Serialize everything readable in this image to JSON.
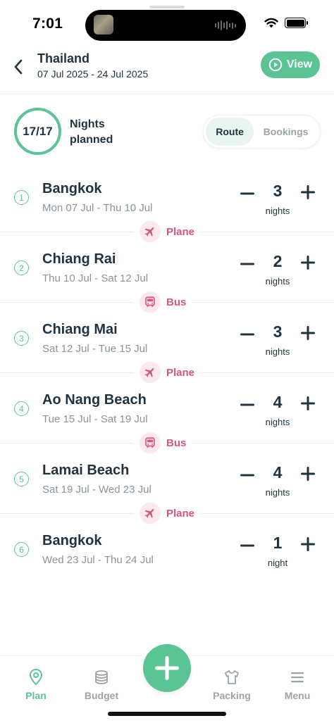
{
  "status_bar": {
    "time": "7:01"
  },
  "header": {
    "title": "Thailand",
    "dates": "07 Jul 2025 - 24 Jul 2025",
    "view_label": "View"
  },
  "summary": {
    "ratio": "17/17",
    "label_line1": "Nights",
    "label_line2": "planned",
    "tabs": [
      {
        "label": "Route",
        "active": true
      },
      {
        "label": "Bookings",
        "active": false
      }
    ]
  },
  "stops": [
    {
      "number": "1",
      "name": "Bangkok",
      "dates": "Mon 07 Jul - Thu 10 Jul",
      "nights": "3",
      "unit": "nights"
    },
    {
      "number": "2",
      "name": "Chiang Rai",
      "dates": "Thu 10 Jul - Sat 12 Jul",
      "nights": "2",
      "unit": "nights"
    },
    {
      "number": "3",
      "name": "Chiang Mai",
      "dates": "Sat 12 Jul - Tue 15 Jul",
      "nights": "3",
      "unit": "nights"
    },
    {
      "number": "4",
      "name": "Ao Nang Beach",
      "dates": "Tue 15 Jul - Sat 19 Jul",
      "nights": "4",
      "unit": "nights"
    },
    {
      "number": "5",
      "name": "Lamai Beach",
      "dates": "Sat 19 Jul - Wed 23 Jul",
      "nights": "4",
      "unit": "nights"
    },
    {
      "number": "6",
      "name": "Bangkok",
      "dates": "Wed 23 Jul - Thu 24 Jul",
      "nights": "1",
      "unit": "night"
    }
  ],
  "transports": [
    {
      "label": "Plane",
      "icon": "plane-icon"
    },
    {
      "label": "Bus",
      "icon": "bus-icon"
    },
    {
      "label": "Plane",
      "icon": "plane-icon"
    },
    {
      "label": "Bus",
      "icon": "bus-icon"
    },
    {
      "label": "Plane",
      "icon": "plane-icon"
    }
  ],
  "tabbar": {
    "plan": "Plan",
    "budget": "Budget",
    "packing": "Packing",
    "menu": "Menu"
  },
  "colors": {
    "accent": "#5bc495",
    "transport": "#d9557c",
    "text": "#1f3340",
    "muted": "#8a949b"
  }
}
